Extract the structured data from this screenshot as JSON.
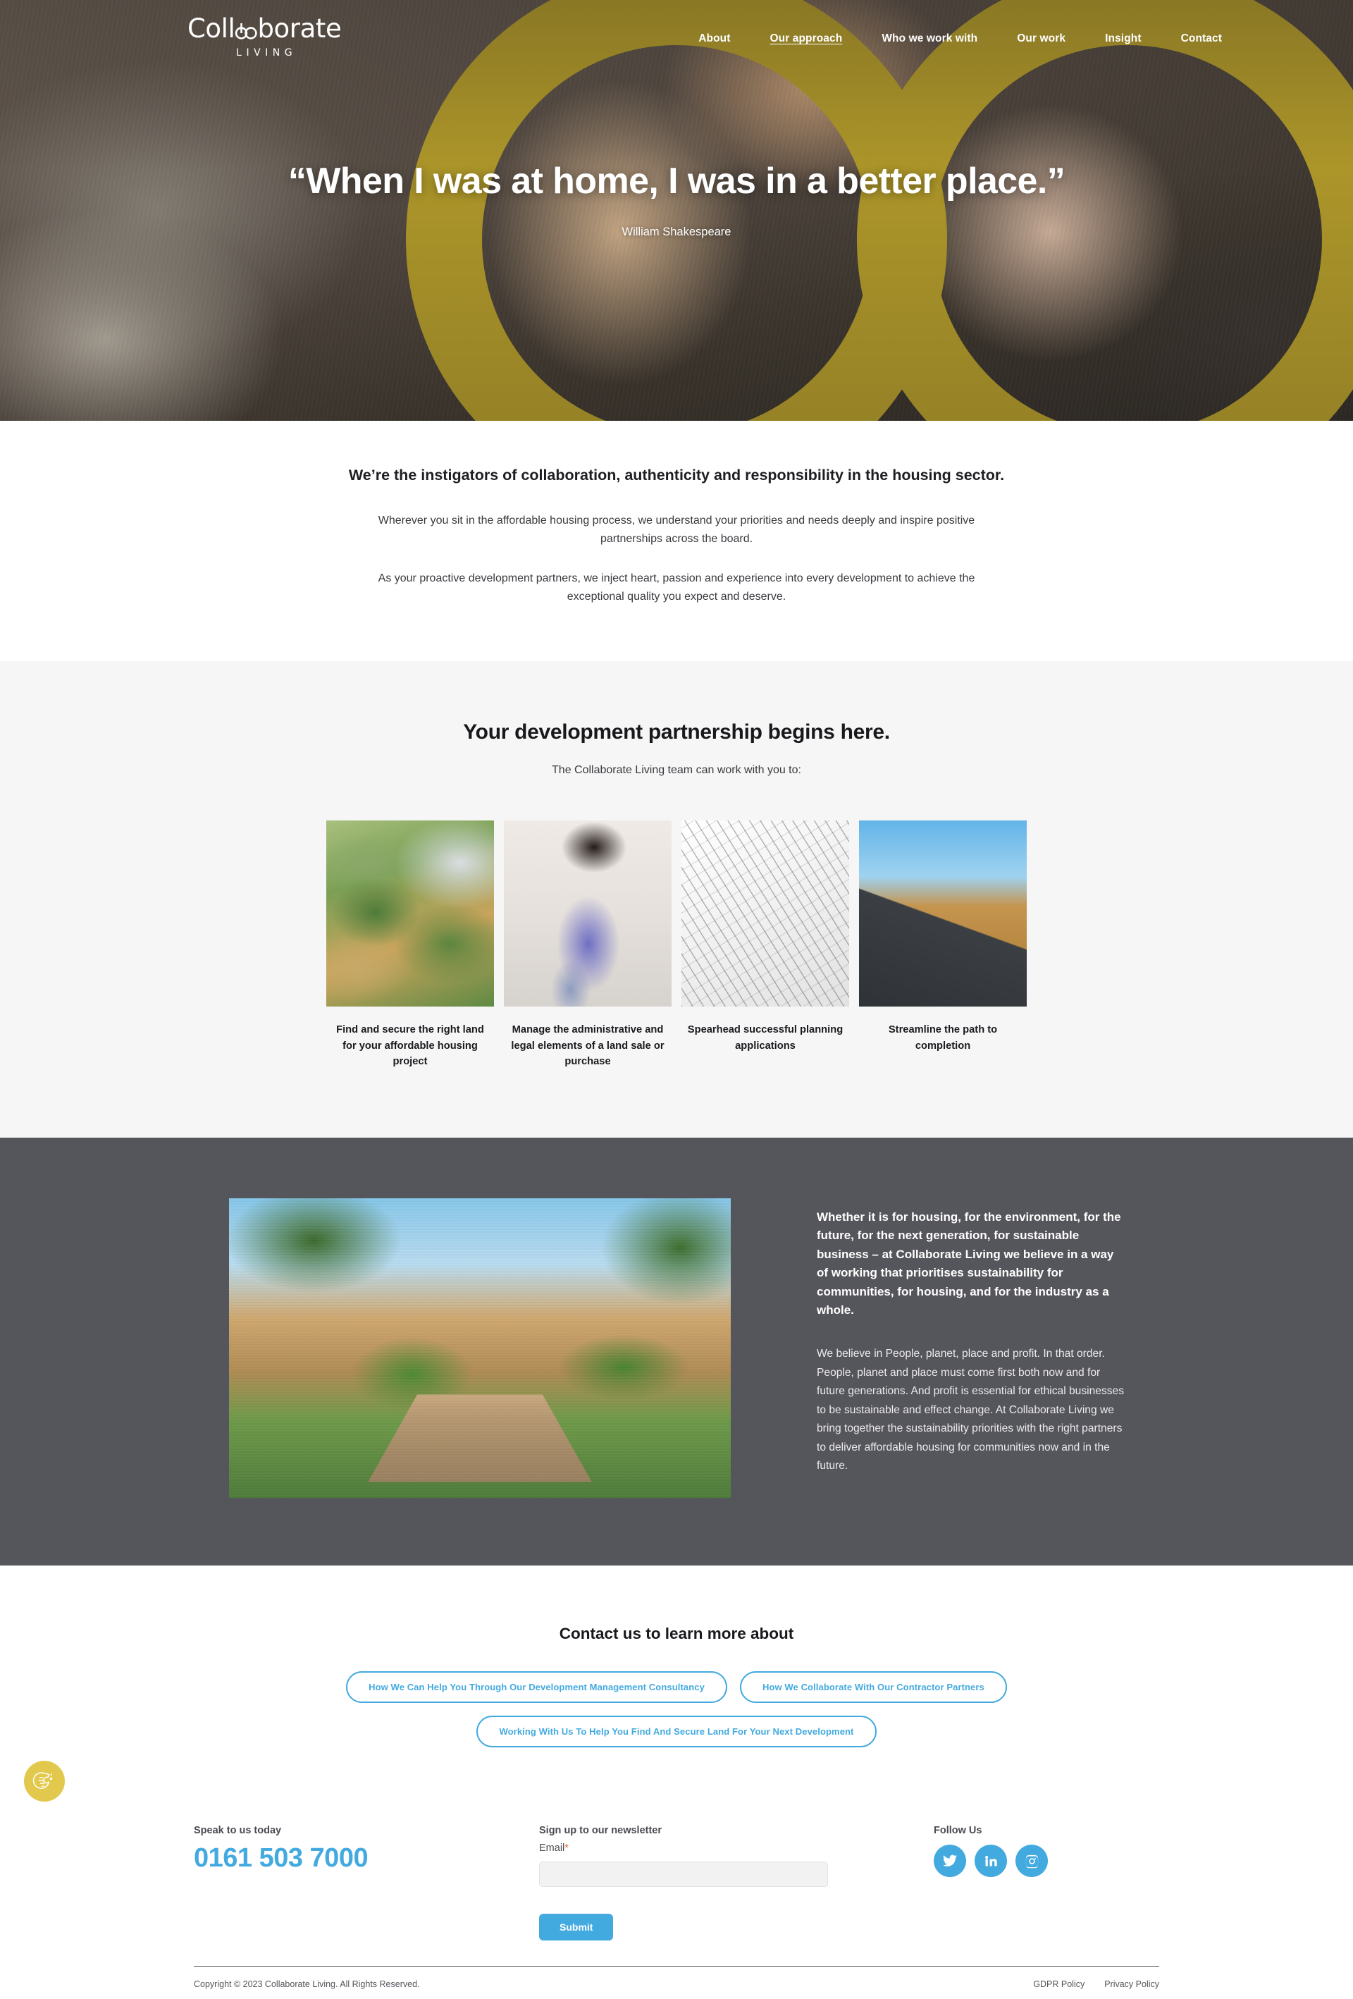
{
  "header": {
    "logo": {
      "word_left": "Coll",
      "word_right": "borate",
      "sub": "LIVING"
    },
    "nav": [
      {
        "label": "About",
        "active": false
      },
      {
        "label": "Our approach",
        "active": true
      },
      {
        "label": "Who we work with",
        "active": false
      },
      {
        "label": "Our work",
        "active": false
      },
      {
        "label": "Insight",
        "active": false
      },
      {
        "label": "Contact",
        "active": false
      }
    ]
  },
  "hero": {
    "quote": "“When I was at home, I was in a better place.”",
    "attribution": "William Shakespeare",
    "accent_color": "#b8a02b"
  },
  "intro": {
    "heading": "We’re the instigators of collaboration, authenticity and responsibility in the housing sector.",
    "paragraph_1": "Wherever you sit in the affordable housing process, we understand your priorities and needs deeply and inspire positive partnerships across the board.",
    "paragraph_2": "As your proactive development partners, we inject heart, passion and experience into every development to achieve the exceptional quality you expect and deserve."
  },
  "partnership": {
    "heading": "Your development partnership begins here.",
    "subheading": "The Collaborate Living team can work with you to:",
    "cards": [
      {
        "image_name": "aerial-landscape-photo",
        "caption": "Find and secure the right land for your affordable housing project"
      },
      {
        "image_name": "woman-signing-document-photo",
        "caption": "Manage the administrative and legal elements of a land sale or purchase"
      },
      {
        "image_name": "architectural-blueprints-photo",
        "caption": "Spearhead successful planning applications"
      },
      {
        "image_name": "modern-timber-house-photo",
        "caption": "Streamline the path to completion"
      }
    ]
  },
  "sustainability": {
    "image_name": "housing-development-render",
    "lead": "Whether it is for housing, for the environment, for the future, for the next generation, for sustainable business – at Collaborate Living we believe in a way of working that prioritises sustainability for communities, for housing, and for the industry as a whole.",
    "body": "We believe in People, planet, place and profit. In that order. People, planet and place must come first both now and for future generations. And profit is essential for ethical businesses to be sustainable and effect change. At Collaborate Living we bring together the sustainability priorities with the right partners to deliver affordable housing for communities now and in the future.",
    "background_color": "#55555c"
  },
  "contact": {
    "heading": "Contact us to learn more about",
    "pills": [
      "How We Can Help You Through Our Development Management Consultancy",
      "How We Collaborate With Our Contractor Partners",
      "Working With Us To Help You Find And Secure Land For Your Next Development"
    ],
    "accent_color": "#43aae0"
  },
  "footer": {
    "speak_label": "Speak to us today",
    "phone": "0161 503 7000",
    "newsletter_label": "Sign up to our newsletter",
    "email_label": "Email",
    "email_required_mark": "*",
    "email_value": "",
    "email_placeholder": "",
    "submit_label": "Submit",
    "follow_label": "Follow Us",
    "social": [
      {
        "name": "twitter",
        "label": "Twitter"
      },
      {
        "name": "linkedin",
        "label": "LinkedIn"
      },
      {
        "name": "instagram",
        "label": "Instagram"
      }
    ],
    "copyright": "Copyright © 2023 Collaborate Living. All Rights Reserved.",
    "legal": [
      {
        "label": "GDPR Policy"
      },
      {
        "label": "Privacy Policy"
      }
    ]
  },
  "cookie_widget": {
    "icon_name": "cookie-icon",
    "color": "#e2c94d"
  }
}
